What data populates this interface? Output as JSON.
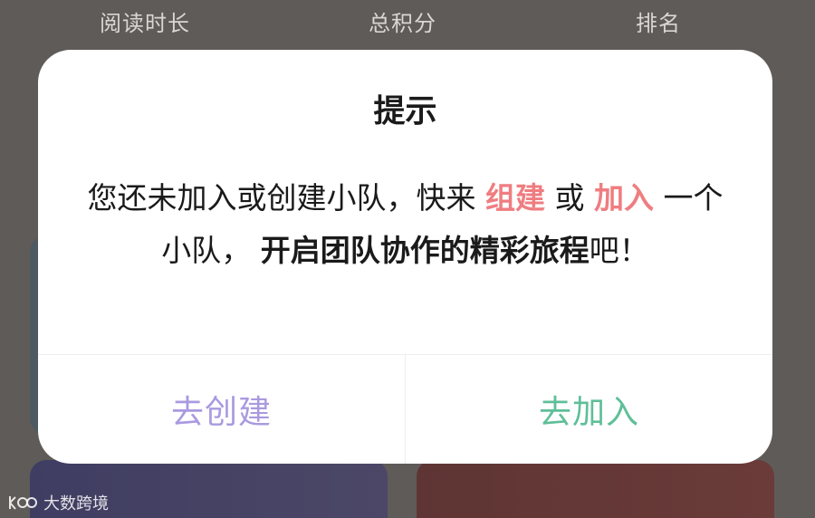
{
  "background": {
    "stats": {
      "reading_time": "阅读时长",
      "total_points": "总积分",
      "rank": "排名"
    }
  },
  "dialog": {
    "title": "提示",
    "message": {
      "part1": "您还未加入或创建小队，快来 ",
      "accent1": "组建",
      "part2": " 或 ",
      "accent2": "加入",
      "part3": " 一个小队， ",
      "bold": "开启团队协作的精彩旅程",
      "part4": "吧！"
    },
    "buttons": {
      "create": "去创建",
      "join": "去加入"
    }
  },
  "watermark": {
    "text": "大数跨境"
  },
  "colors": {
    "accent": "#ef7d80",
    "create_button": "#a99ae0",
    "join_button": "#5fbf98",
    "backdrop": "#5f5b58"
  }
}
